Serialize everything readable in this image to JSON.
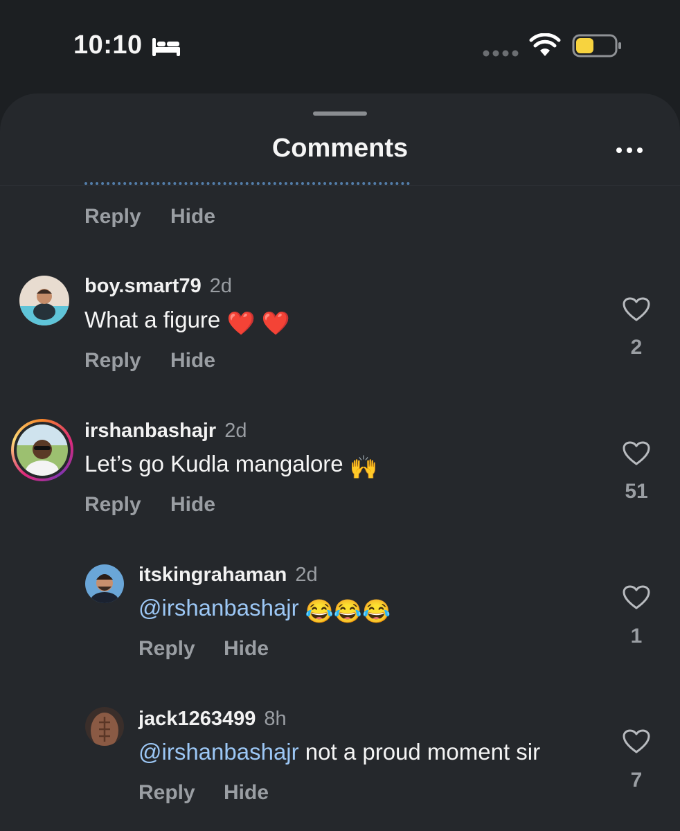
{
  "status_bar": {
    "time": "10:10",
    "icons": [
      "bed-icon",
      "signal-dots-icon",
      "wifi-icon",
      "battery-icon"
    ],
    "battery_color": "#f7d33f"
  },
  "sheet": {
    "title": "Comments",
    "more_icon": "more-horizontal-icon"
  },
  "actions": {
    "reply": "Reply",
    "hide": "Hide"
  },
  "comments": [
    {
      "username": "boy.smart79",
      "time_ago": "2d",
      "text": "What a figure",
      "emojis": "❤️ ❤️",
      "likes": "2"
    },
    {
      "username": "irshanbashajr",
      "time_ago": "2d",
      "text": "Let’s go Kudla mangalore",
      "emojis": "🙌",
      "likes": "51",
      "has_story": true
    }
  ],
  "replies": [
    {
      "username": "itskingrahaman",
      "time_ago": "2d",
      "mention": "@irshanbashajr",
      "text": "",
      "emojis": "😂😂😂",
      "likes": "1"
    },
    {
      "username": "jack1263499",
      "time_ago": "8h",
      "mention": "@irshanbashajr",
      "text": "not a proud moment sir",
      "likes": "7"
    }
  ],
  "colors": {
    "background": "#1c1f22",
    "sheet": "#25282c",
    "mention": "#9cc7f5",
    "secondary_text": "#9a9ea3"
  }
}
